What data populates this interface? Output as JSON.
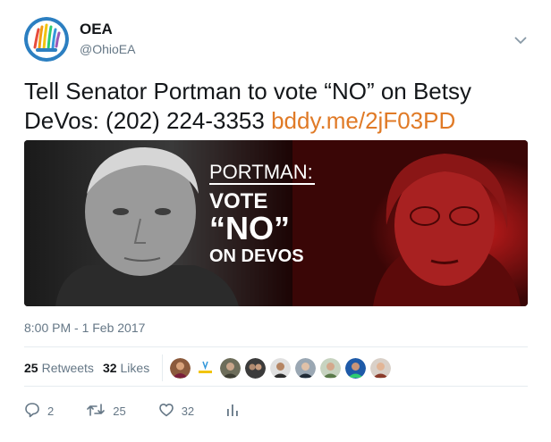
{
  "user": {
    "name": "OEA",
    "handle": "@OhioEA"
  },
  "tweet": {
    "text": "Tell Senator Portman to vote “NO” on Betsy DeVos: (202) 224-3353 ",
    "link": "bddy.me/2jF03PD",
    "timestamp": "8:00 PM - 1 Feb 2017"
  },
  "media": {
    "headline": "PORTMAN:",
    "line1": "VOTE",
    "line2": "“NO”",
    "line3": "ON DEVOS"
  },
  "stats": {
    "retweets_count": "25",
    "retweets_label": "Retweets",
    "likes_count": "32",
    "likes_label": "Likes"
  },
  "actions": {
    "reply_count": "2",
    "retweet_count": "25",
    "like_count": "32"
  },
  "colors": {
    "link": "#e07a26",
    "muted": "#657786",
    "media_red": "#b01919"
  },
  "icons": [
    "chevron-down-icon",
    "reply-icon",
    "retweet-icon",
    "heart-icon",
    "analytics-icon"
  ]
}
